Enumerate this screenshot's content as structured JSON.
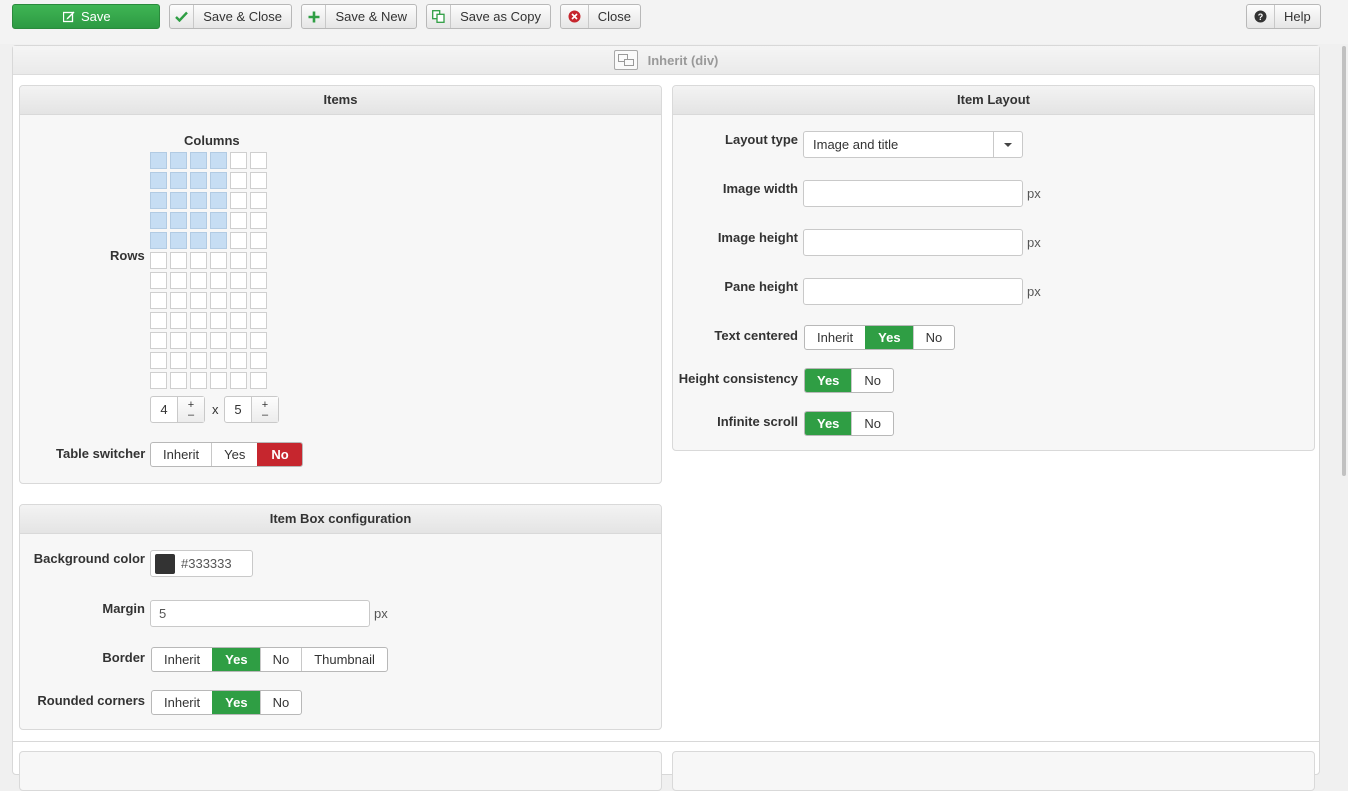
{
  "toolbar": {
    "save": "Save",
    "save_close": "Save & Close",
    "save_new": "Save & New",
    "save_copy": "Save as Copy",
    "close": "Close",
    "help": "Help"
  },
  "main": {
    "title": "Inherit (div)"
  },
  "items_panel": {
    "title": "Items",
    "columns_label": "Columns",
    "rows_label": "Rows",
    "grid": {
      "total_columns": 6,
      "total_rows": 12,
      "selected_columns": 4,
      "selected_rows": 5
    },
    "columns_value": "4",
    "times": "x",
    "rows_value": "5",
    "plus": "+",
    "minus": "–",
    "table_switcher": {
      "label": "Table switcher",
      "options": [
        "Inherit",
        "Yes",
        "No"
      ],
      "selected": "No"
    }
  },
  "item_layout": {
    "title": "Item Layout",
    "layout_type": {
      "label": "Layout type",
      "value": "Image and title"
    },
    "image_width": {
      "label": "Image width",
      "value": "",
      "unit": "px"
    },
    "image_height": {
      "label": "Image height",
      "value": "",
      "unit": "px"
    },
    "pane_height": {
      "label": "Pane height",
      "value": "",
      "unit": "px"
    },
    "text_centered": {
      "label": "Text centered",
      "options": [
        "Inherit",
        "Yes",
        "No"
      ],
      "selected": "Yes"
    },
    "height_consistency": {
      "label": "Height consistency",
      "options": [
        "Yes",
        "No"
      ],
      "selected": "Yes"
    },
    "infinite_scroll": {
      "label": "Infinite scroll",
      "options": [
        "Yes",
        "No"
      ],
      "selected": "Yes"
    }
  },
  "item_box": {
    "title": "Item Box configuration",
    "background_color": {
      "label": "Background color",
      "value": "#333333"
    },
    "margin": {
      "label": "Margin",
      "value": "5",
      "unit": "px"
    },
    "border": {
      "label": "Border",
      "options": [
        "Inherit",
        "Yes",
        "No",
        "Thumbnail"
      ],
      "selected": "Yes"
    },
    "rounded_corners": {
      "label": "Rounded corners",
      "options": [
        "Inherit",
        "Yes",
        "No"
      ],
      "selected": "Yes"
    }
  },
  "colors": {
    "green": "#2f9e44",
    "red": "#c6262e",
    "cell_selected": "#c6ddf3"
  },
  "icons": {
    "save": "pencil-square-icon",
    "save_close": "checkmark-icon",
    "save_new": "plus-icon",
    "save_copy": "copy-icon",
    "close": "close-circle-icon",
    "help": "question-circle-icon",
    "header": "layout-icon"
  }
}
